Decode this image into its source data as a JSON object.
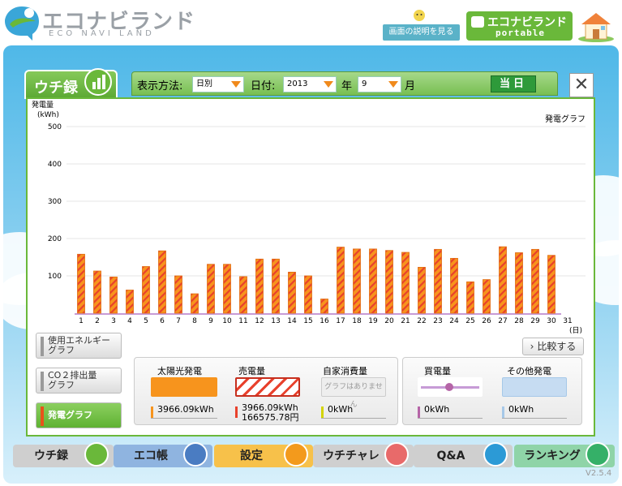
{
  "header": {
    "logo_title": "エコナビランド",
    "logo_sub": "ECO NAVI LAND",
    "help_label": "画面の説明を見る",
    "portable_title": "エコナビランド",
    "portable_sub": "portable"
  },
  "tab": {
    "label": "ウチ録",
    "icon": "bar-chart-icon"
  },
  "controls": {
    "display_method_label": "表示方法:",
    "display_method_value": "日別",
    "date_label": "日付:",
    "year_value": "2013",
    "year_label": "年",
    "month_value": "9",
    "month_label": "月",
    "today_label": "当日",
    "close_label": "✕"
  },
  "side_buttons": [
    {
      "label": "使用エネルギーグラフ",
      "line1": "使用エネルギー",
      "line2": "グラフ"
    },
    {
      "label": "CO2排出量グラフ",
      "line1": "CO２排出量",
      "line2": "グラフ"
    },
    {
      "label": "発電グラフ",
      "line1": "発電グラフ",
      "line2": ""
    }
  ],
  "compare_label": "比較する",
  "legend": {
    "solar": {
      "title": "太陽光発電",
      "value": "3966.09kWh",
      "color": "#f7941d"
    },
    "sold": {
      "title": "売電量",
      "value": "3966.09kWh",
      "yen": "166575.78円",
      "color": "#e8412c"
    },
    "self": {
      "title": "自家消費量",
      "value": "0kWh",
      "placeholder": "グラフはありません",
      "color": "#d4d400"
    },
    "bought": {
      "title": "買電量",
      "value": "0kWh",
      "color": "#b565a7"
    },
    "other": {
      "title": "その他発電",
      "value": "0kWh",
      "color": "#a6c8e8"
    }
  },
  "nav": [
    {
      "label": "ウチ録",
      "color": "#cfcfcf",
      "icon": "bar-chart-icon",
      "icon_color": "#6ab83a"
    },
    {
      "label": "エコ帳",
      "color": "#8fb4e0",
      "icon": "notebook-icon",
      "icon_color": "#4a7cc2"
    },
    {
      "label": "設定",
      "color": "#f7c14a",
      "icon": "wrench-icon",
      "icon_color": "#f39a1c"
    },
    {
      "label": "ウチチャレ",
      "color": "#cfcfcf",
      "icon": "flag-icon",
      "icon_color": "#e86a6a"
    },
    {
      "label": "Q&A",
      "color": "#cfcfcf",
      "icon": "question-icon",
      "icon_color": "#2c9ad6"
    },
    {
      "label": "ランキング",
      "color": "#8fd4a8",
      "icon": "crown-icon",
      "icon_color": "#35b068"
    }
  ],
  "version": "V2.5.4",
  "chart_data": {
    "type": "bar",
    "title": "発電グラフ",
    "ylabel": "発電量 (kWh)",
    "xlabel": "(日)",
    "ylim": [
      0,
      500
    ],
    "yticks": [
      100,
      200,
      300,
      400,
      500
    ],
    "categories": [
      "1",
      "2",
      "3",
      "4",
      "5",
      "6",
      "7",
      "8",
      "9",
      "10",
      "11",
      "12",
      "13",
      "14",
      "15",
      "16",
      "17",
      "18",
      "19",
      "20",
      "21",
      "22",
      "23",
      "24",
      "25",
      "26",
      "27",
      "28",
      "29",
      "30",
      "31"
    ],
    "series": [
      {
        "values": [
          158,
          113,
          97,
          62,
          125,
          167,
          100,
          52,
          131,
          131,
          98,
          145,
          145,
          110,
          100,
          38,
          177,
          172,
          172,
          168,
          163,
          123,
          171,
          147,
          84,
          90,
          178,
          162,
          171,
          155,
          0
        ]
      }
    ],
    "grid": true,
    "bar_color": "#f7941d",
    "bar_stripe_color": "#e8412c",
    "baseline_color": "#c79bd6"
  }
}
